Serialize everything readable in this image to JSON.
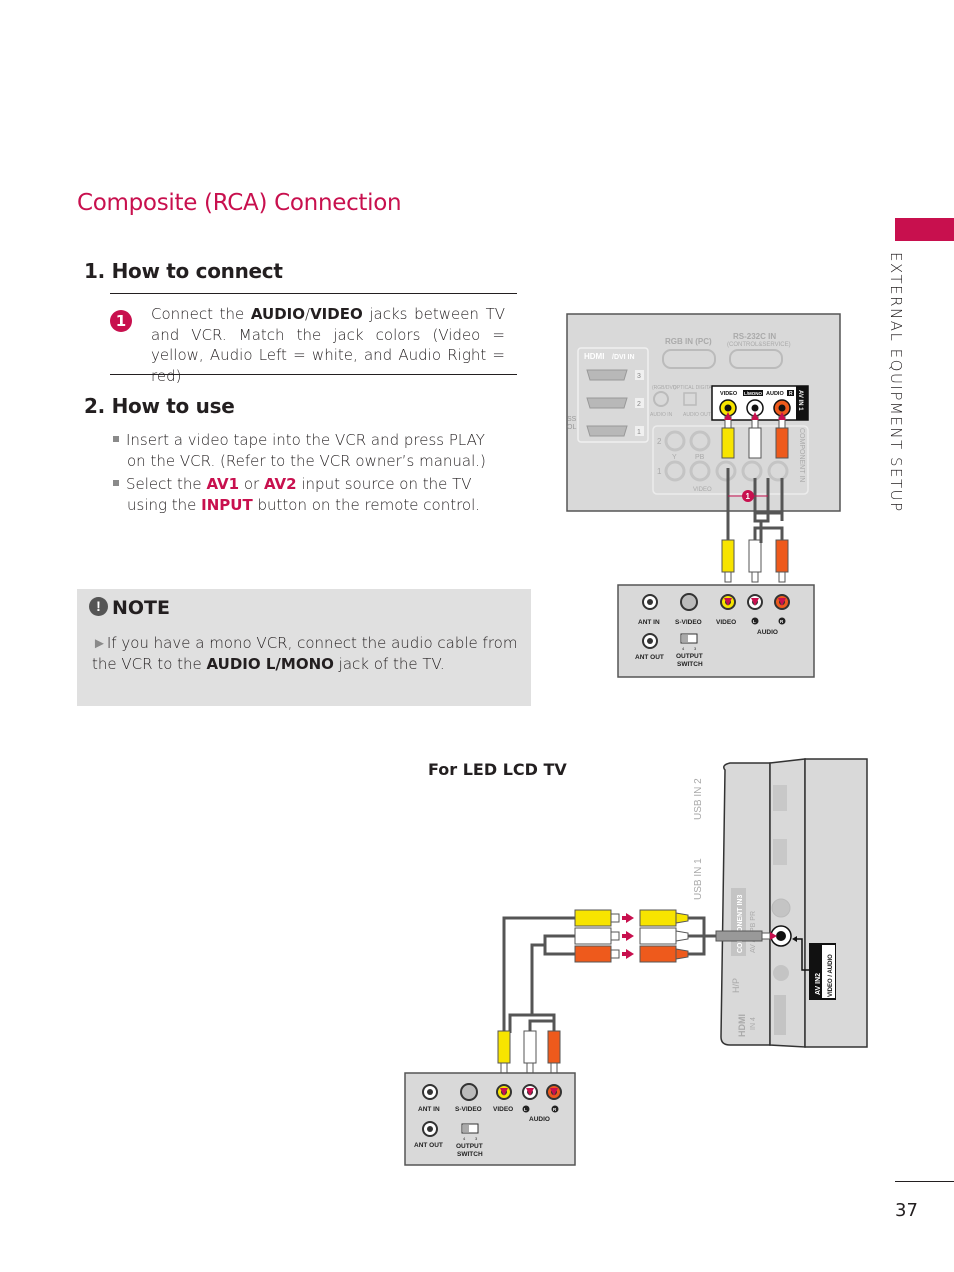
{
  "page": {
    "title": "Composite (RCA) Connection",
    "side_tab_label": "EXTERNAL EQUIPMENT SETUP",
    "page_number": "37",
    "accent_color": "#c8104e"
  },
  "how_to_connect": {
    "heading": "1. How to connect",
    "step_number": "1",
    "text_before": "Connect the ",
    "bold_1": "AUDIO",
    "slash": "/",
    "bold_2": "VIDEO",
    "text_after": " jacks between TV and VCR. Match the jack colors (Video = yellow, Audio Left = white, and Audio Right = red)"
  },
  "how_to_use": {
    "heading": "2. How to use",
    "bullets": [
      {
        "text": "Insert a video tape into the VCR and press PLAY on the VCR. (Refer to the VCR owner’s manual.)"
      },
      {
        "pre": "Select the ",
        "av1": "AV1",
        "or": " or ",
        "av2": "AV2",
        "mid": " input source on the TV using the ",
        "input": "INPUT",
        "post": " button on the remote control."
      }
    ]
  },
  "note": {
    "icon": "!",
    "heading": "NOTE",
    "arrow": "►",
    "text_before": "If you have a mono VCR, connect the audio cable from the VCR to the ",
    "bold": "AUDIO L/MONO",
    "text_after": " jack of the TV."
  },
  "diagram_top": {
    "tv_labels": {
      "rgb_in": "RGB IN (PC)",
      "rs232": "RS-232C IN",
      "rs232_sub": "(CONTROL&SERVICE)",
      "hdmi_dvi": "/DVI IN",
      "hdmi_logo": "HDMI",
      "hdmi_ports": [
        "3",
        "2",
        "1"
      ],
      "rgb_dvi_audio": "(RGB/DVI)",
      "optical": "OPTICAL DIGITAL",
      "audio_in": "AUDIO IN",
      "audio_out": "AUDIO OUT",
      "av_video": "VIDEO",
      "av_lmono": "L/MONO",
      "av_audio": "AUDIO",
      "av_r": "R",
      "av_in1": "AV IN 1",
      "component_in": "COMPONENT IN",
      "comp_row2": "2",
      "comp_row1": "1",
      "comp_y": "Y",
      "comp_pb": "PB",
      "comp_video": "VIDEO",
      "edge_text_1": "SS",
      "edge_text_2": "OL"
    },
    "callout": "1",
    "vcr": {
      "ant_in": "ANT IN",
      "s_video": "S-VIDEO",
      "video": "VIDEO",
      "l": "L",
      "r": "R",
      "audio": "AUDIO",
      "ant_out": "ANT OUT",
      "output_switch_1": "OUTPUT",
      "output_switch_2": "SWITCH",
      "ch4": "4",
      "ch3": "3"
    }
  },
  "diagram_bottom": {
    "label": "For LED LCD TV",
    "tv_labels": {
      "usb2": "USB IN 2",
      "usb1": "USB IN 1",
      "component_in3": "COMPONENT IN3",
      "comp_sub": "AV / Y  PB  PR",
      "hp": "H/P",
      "hdmi": "HDMI",
      "hdmi_in4": "IN 4",
      "av_in2": "AV IN2",
      "video_audio": "VIDEO / AUDIO"
    },
    "vcr": {
      "ant_in": "ANT IN",
      "s_video": "S-VIDEO",
      "video": "VIDEO",
      "l": "L",
      "r": "R",
      "audio": "AUDIO",
      "ant_out": "ANT OUT",
      "output_switch_1": "OUTPUT",
      "output_switch_2": "SWITCH",
      "ch4": "4",
      "ch3": "3"
    }
  }
}
